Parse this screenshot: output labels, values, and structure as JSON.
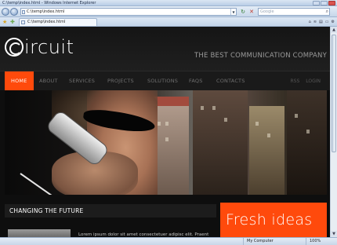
{
  "browser": {
    "title": "C:\\temp\\index.html - Windows Internet Explorer",
    "address": "C:\\temp\\index.html",
    "search_placeholder": "Google",
    "tab_label": "C:\\temp\\index.html"
  },
  "site": {
    "logo_text": "ircuit",
    "tagline": "THE BEST COMMUNICATION COMPANY",
    "nav": {
      "items": [
        {
          "label": "HOME",
          "active": true
        },
        {
          "label": "ABOUT"
        },
        {
          "label": "SERVICES"
        },
        {
          "label": "PROJECTS"
        },
        {
          "label": "SOLUTIONS"
        },
        {
          "label": "FAQS"
        },
        {
          "label": "CONTACTS"
        }
      ],
      "rss": "RSS",
      "login": "LOGIN"
    },
    "section_title": "CHANGING THE FUTURE",
    "body_text": "Lorem ipsum dolor sit amet consectetuer adipisc elit. Praent",
    "promo": "Fresh ideas"
  },
  "status": {
    "zone": "My Computer",
    "zoom": "100%"
  },
  "colors": {
    "accent": "#ff4a0c",
    "background": "#0e0e0e"
  }
}
